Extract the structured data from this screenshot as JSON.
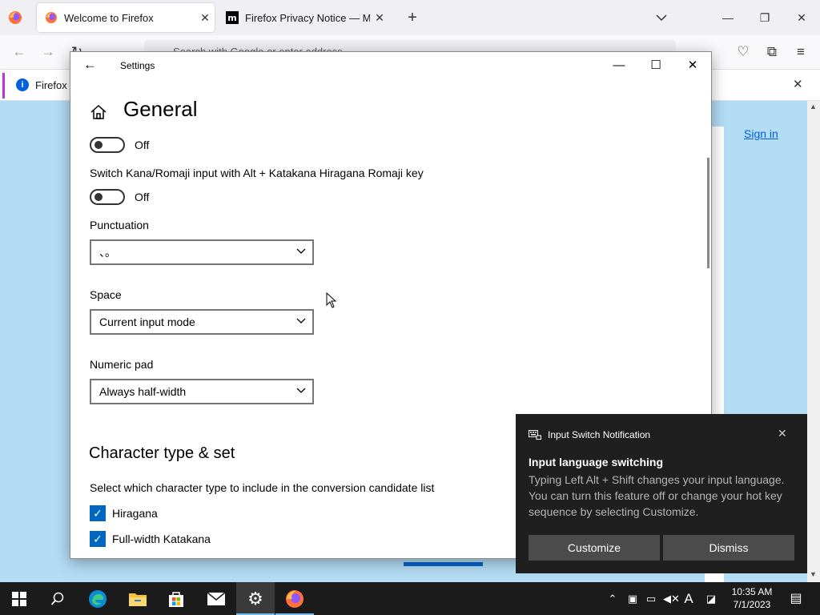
{
  "browser": {
    "tabs": [
      {
        "title": "Welcome to Firefox",
        "active": true
      },
      {
        "title": "Firefox Privacy Notice — Mozil",
        "active": false
      }
    ],
    "urlbar_placeholder": "Search with Google or enter address",
    "notice_text": "Firefox a",
    "signin_label": "Sign in"
  },
  "settings": {
    "window_title": "Settings",
    "heading": "General",
    "toggle1_state": "Off",
    "kana_label": "Switch Kana/Romaji input with Alt + Katakana Hiragana Romaji key",
    "toggle2_state": "Off",
    "punctuation_label": "Punctuation",
    "punctuation_value": "、。",
    "space_label": "Space",
    "space_value": "Current input mode",
    "numeric_label": "Numeric pad",
    "numeric_value": "Always half-width",
    "section_heading": "Character type & set",
    "section_desc": "Select which character type to include in the conversion candidate list",
    "checkboxes": [
      {
        "label": "Hiragana",
        "checked": true
      },
      {
        "label": "Full-width Katakana",
        "checked": true
      }
    ]
  },
  "toast": {
    "app_name": "Input Switch Notification",
    "title": "Input language switching",
    "body": "Typing Left Alt + Shift changes your input language. You can turn this feature off or change your hot key sequence by selecting Customize.",
    "customize_label": "Customize",
    "dismiss_label": "Dismiss"
  },
  "taskbar": {
    "time": "10:35 AM",
    "date": "7/1/2023",
    "ime_indicator": "A"
  },
  "colors": {
    "accent": "#0067c0",
    "toast_bg": "#1f1f1f",
    "taskbar_bg": "#1b1b1b",
    "page_bg": "#b3dcf5"
  }
}
